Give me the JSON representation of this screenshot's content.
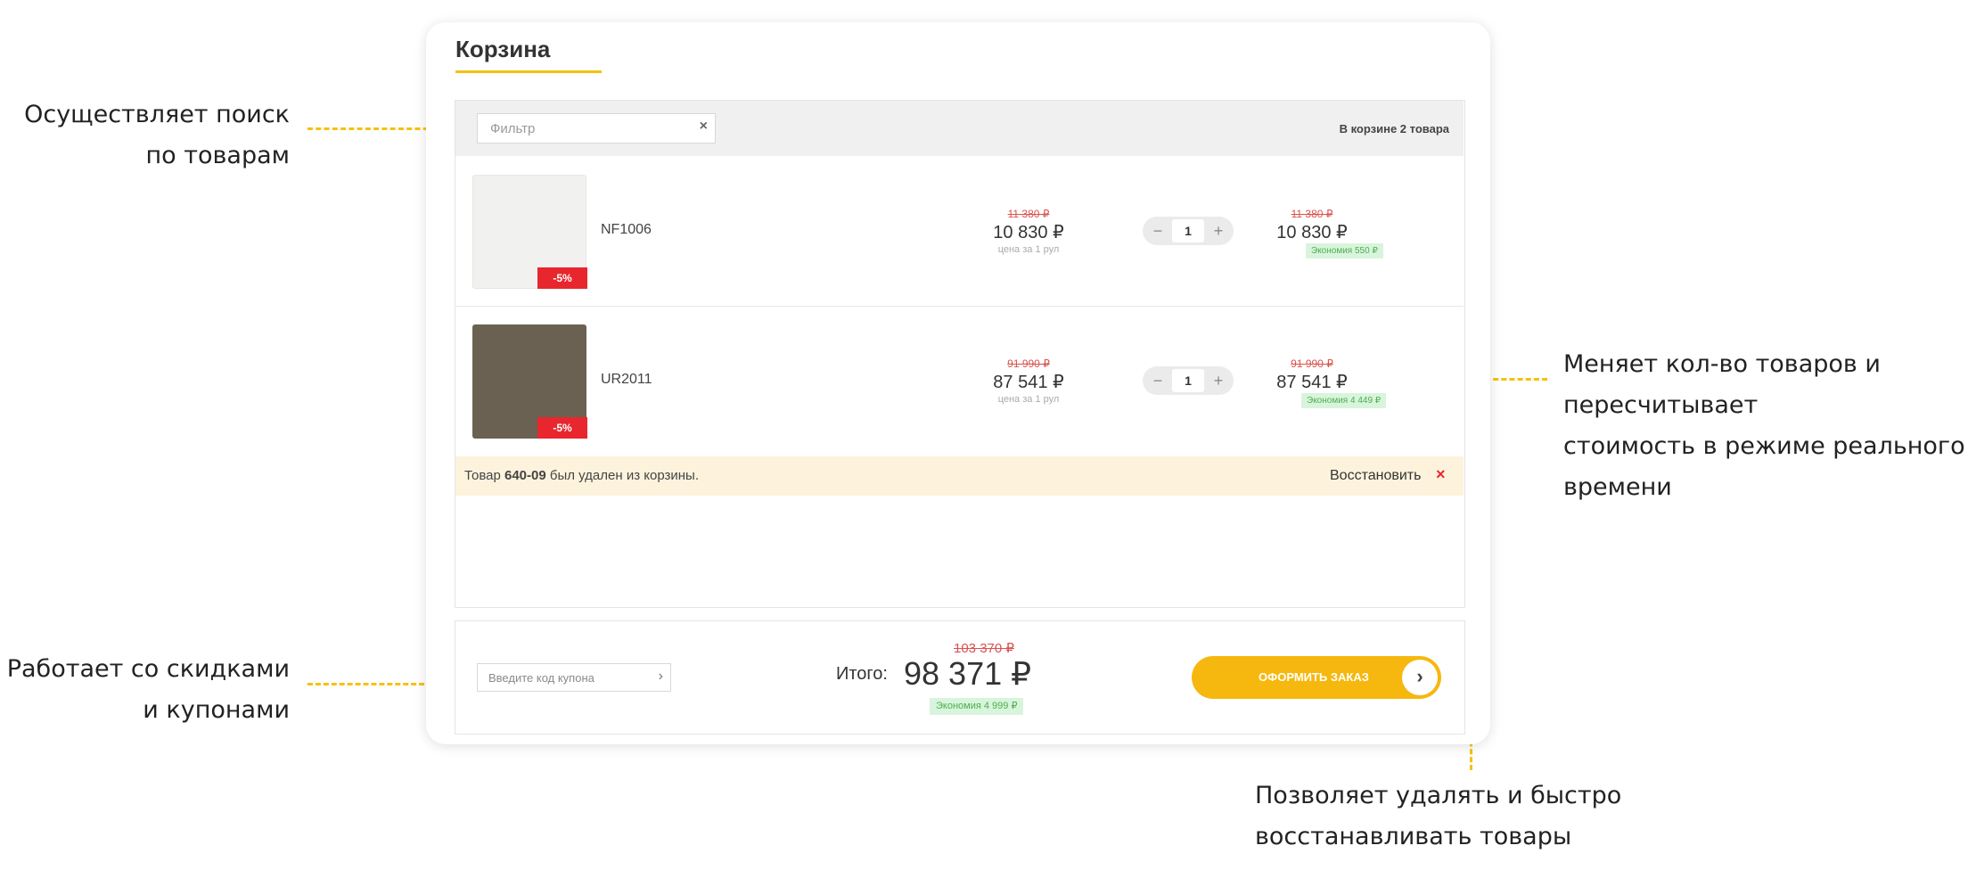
{
  "annotations": {
    "search": {
      "lines": [
        "Осуществляет поиск",
        "по товарам"
      ]
    },
    "quantity": {
      "lines": [
        "Меняет кол-во товаров и",
        "пересчитывает",
        "стоимость в режиме реального",
        "времени"
      ]
    },
    "coupons": {
      "lines": [
        "Работает со скидками",
        "и купонами"
      ]
    },
    "restore": {
      "lines": [
        "Позволяет удалять и быстро",
        "восстанавливать товары"
      ]
    }
  },
  "cart": {
    "title": "Корзина",
    "filter_placeholder": "Фильтр",
    "filter_clear": "×",
    "items_count": "В корзине 2 товара",
    "items": [
      {
        "sku": "NF1006",
        "discount": "-5%",
        "old_price": "11 380 ₽",
        "price": "10 830 ₽",
        "unit_note": "цена за 1 рул",
        "qty": "1",
        "total_old": "11 380 ₽",
        "total": "10 830 ₽",
        "saving": "Экономия 550 ₽"
      },
      {
        "sku": "UR2011",
        "discount": "-5%",
        "old_price": "91 990 ₽",
        "price": "87 541 ₽",
        "unit_note": "цена за 1 рул",
        "qty": "1",
        "total_old": "91 990 ₽",
        "total": "87 541 ₽",
        "saving": "Экономия 4 449 ₽"
      }
    ],
    "stepper_minus": "−",
    "stepper_plus": "+",
    "removed": {
      "prefix": "Товар ",
      "code": "640-09",
      "suffix": " был удален из корзины.",
      "restore_label": "Восстановить",
      "close": "×"
    },
    "footer": {
      "coupon_placeholder": "Введите код купона",
      "coupon_arrow": "›",
      "total_label": "Итого:",
      "total_old": "103 370 ₽",
      "total": "98 371 ₽",
      "saving": "Экономия 4 999 ₽",
      "checkout_label": "ОФОРМИТЬ ЗАКАЗ",
      "checkout_arrow": "›"
    }
  },
  "colors": {
    "accent": "#f6c10f",
    "button": "#f6b80e",
    "discount_badge": "#e8262e",
    "old_price": "#d9534f",
    "saving_bg": "#d9f4dc",
    "removed_bg": "#fdf3dd"
  }
}
